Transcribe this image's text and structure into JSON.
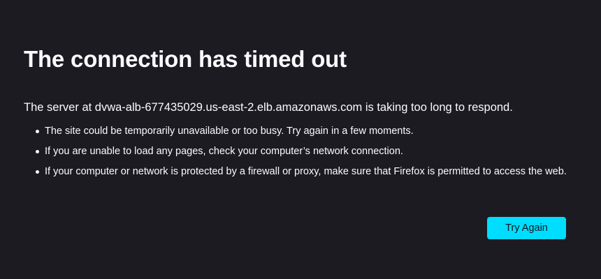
{
  "error": {
    "title": "The connection has timed out",
    "short_description": "The server at dvwa-alb-677435029.us-east-2.elb.amazonaws.com is taking too long to respond.",
    "tips": [
      "The site could be temporarily unavailable or too busy. Try again in a few moments.",
      "If you are unable to load any pages, check your computer’s network connection.",
      "If your computer or network is protected by a firewall or proxy, make sure that Firefox is permitted to access the web."
    ],
    "try_again_label": "Try Again"
  },
  "colors": {
    "background": "#1c1b22",
    "text": "#fbfbfe",
    "button_accent": "#00ddff"
  }
}
